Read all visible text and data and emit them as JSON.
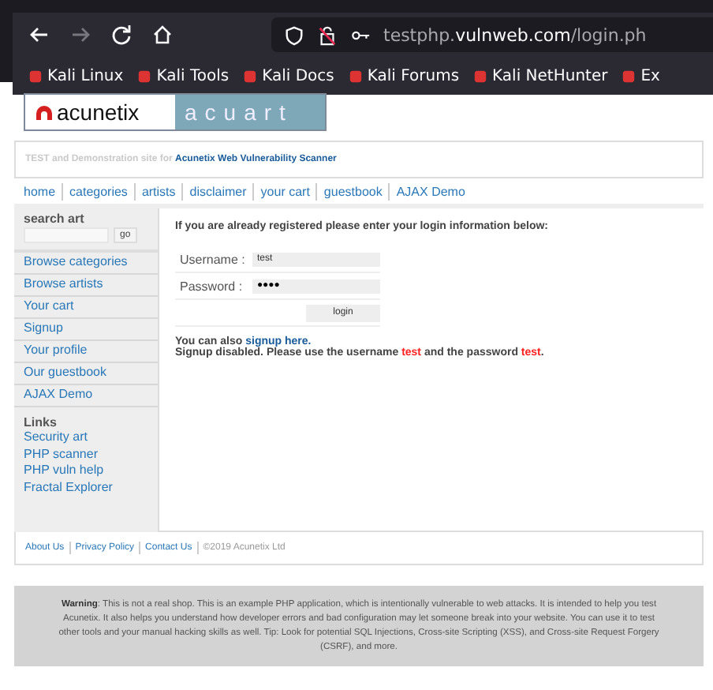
{
  "browser": {
    "url": {
      "prefix": "testphp.",
      "domain": "vulnweb.com",
      "path": "/login.ph"
    },
    "bookmarks": [
      "Kali Linux",
      "Kali Tools",
      "Kali Docs",
      "Kali Forums",
      "Kali NetHunter",
      "Ex"
    ]
  },
  "logo": {
    "brand": "acunetix",
    "site": "acuart"
  },
  "tagline": {
    "text": "TEST and Demonstration site for",
    "link": "Acunetix Web Vulnerability Scanner"
  },
  "nav": [
    "home",
    "categories",
    "artists",
    "disclaimer",
    "your cart",
    "guestbook",
    "AJAX Demo"
  ],
  "sidebar": {
    "search_title": "search art",
    "search_button": "go",
    "items": [
      "Browse categories",
      "Browse artists",
      "Your cart",
      "Signup",
      "Your profile",
      "Our guestbook",
      "AJAX Demo"
    ],
    "links_title": "Links",
    "links": [
      "Security art",
      "PHP scanner",
      "PHP vuln help",
      "Fractal Explorer"
    ]
  },
  "login": {
    "intro": "If you are already registered please enter your login information below:",
    "username_label": "Username :",
    "username": "test",
    "password_label": "Password :",
    "password": "●●●●",
    "button": "login",
    "also_text": "You can also",
    "also_link": "signup here.",
    "note": "Signup disabled. Please use the username **test** and the password **test**."
  },
  "footer": {
    "links": [
      "About Us",
      "Privacy Policy",
      "Contact Us"
    ],
    "copyright": "©2019 Acunetix Ltd"
  },
  "warning": {
    "text": "**Warning**: This is not a real shop. This is an example PHP application, which is intentionally vulnerable to web attacks. It is intended to help you test Acunetix. It also helps you understand how developer errors and bad configuration may let someone break into your website. You can use it to test other tools and your manual hacking skills as well. Tip: Look for potential SQL Injections, Cross-site Scripting (XSS), and Cross-site Request Forgery (CSRF), and more."
  }
}
